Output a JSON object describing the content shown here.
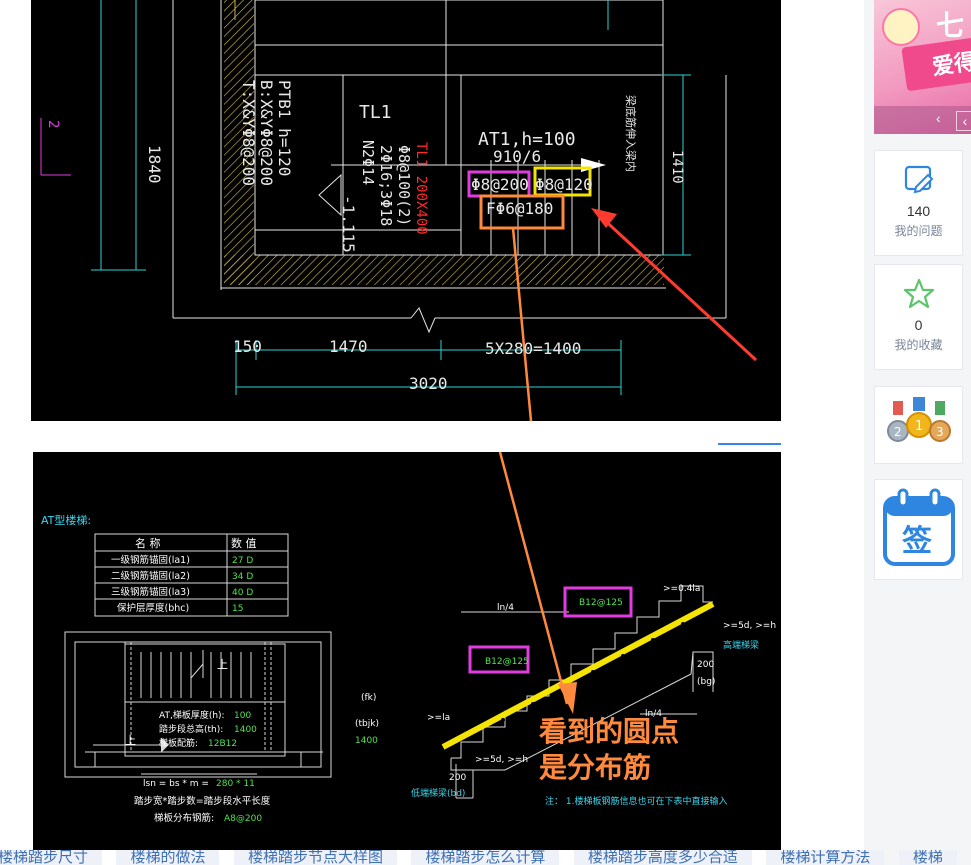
{
  "cad_top": {
    "texts": {
      "ptb1": "PTB1 h=120",
      "ptb1_bx": "B:X&YΦ8@200",
      "ptb1_tx": "T:X&YΦ8@200",
      "tl1": "TL1",
      "tl1_red": "TL1 200X400",
      "tl1_a": "Φ8@100(2)",
      "tl1_b": "2Φ16;3Φ18",
      "tl1_c": "N2Φ14",
      "elev": "-1.115",
      "at1": "AT1,h=100",
      "at1_b": "910/6",
      "rebar_mag": "Φ8@200",
      "rebar_yel": "Φ8@120",
      "rebar_or": "FΦ6@180",
      "side_cn": "梁底筋伸入梁内",
      "dim_1840": "1840",
      "dim_1410": "1410",
      "dim_2": "2",
      "dim_150": "150",
      "dim_1470": "1470",
      "dim_step": "5X280=1400",
      "dim_3020": "3020"
    }
  },
  "cad_bottom": {
    "title": "AT型楼梯:",
    "table": {
      "headers": [
        "名 称",
        "数 值"
      ],
      "rows": [
        {
          "name": "一级钢筋锚固(la1)",
          "value": "27 D"
        },
        {
          "name": "二级钢筋锚固(la2)",
          "value": "34 D"
        },
        {
          "name": "三级钢筋锚固(la3)",
          "value": "40 D"
        },
        {
          "name": "保护层厚度(bhc)",
          "value": "15"
        }
      ]
    },
    "plan": {
      "up1": "上",
      "up2": "上",
      "fk": "(fk)",
      "tbjk": "(tbjk)",
      "w1400": "1400",
      "t_label": "AT,梯板厚度(h):",
      "t_val": "100",
      "th_label": "踏步段总高(th):",
      "th_val": "1400",
      "bar_label": "梯板配筋:",
      "bar_val": "12B12",
      "lsn_left": "lsn = bs * m = ",
      "lsn_val": "280 * 11",
      "formula": "踏步宽*踏步数=踏步段水平长度",
      "dist_label": "梯板分布钢筋:",
      "dist_val": "A8@200"
    },
    "section": {
      "box1": "B12@125",
      "box2": "B12@125",
      "ln4_a": "ln/4",
      "ln4_b": "ln/4",
      "top_04": ">=0.4la",
      "right_5d": ">=5d, >=h",
      "high_beam": "高端梯梁",
      "w200_r": "200",
      "bg": "(bg)",
      "la": ">=la",
      "bot_5d": ">=5d, >=h",
      "w200_l": "200",
      "low_beam": "低端梯梁(bd)",
      "note": "注： 1.楼梯板钢筋信息也可在下表中直接输入"
    },
    "annotation_line1": "看到的圆点",
    "annotation_line2": "是分布筋"
  },
  "tags": [
    "楼梯踏步尺寸",
    "楼梯的做法",
    "楼梯踏步节点大样图",
    "楼梯踏步怎么计算",
    "楼梯踏步高度多少合适",
    "楼梯计算方法",
    "楼梯"
  ],
  "sidebar": {
    "banner_text": "爱得",
    "banner_top": "七",
    "questions_count": "140",
    "questions_label": "我的问题",
    "favorites_count": "0",
    "favorites_label": "我的收藏",
    "medal_2": "2",
    "medal_1": "1",
    "medal_3": "3",
    "signin": "签",
    "prev_arrow": "‹",
    "next_arrow": "‹",
    "colors": {
      "accent": "#2f86e0",
      "medal_gold": "#f2b51b",
      "star": "#5cc46a"
    }
  }
}
